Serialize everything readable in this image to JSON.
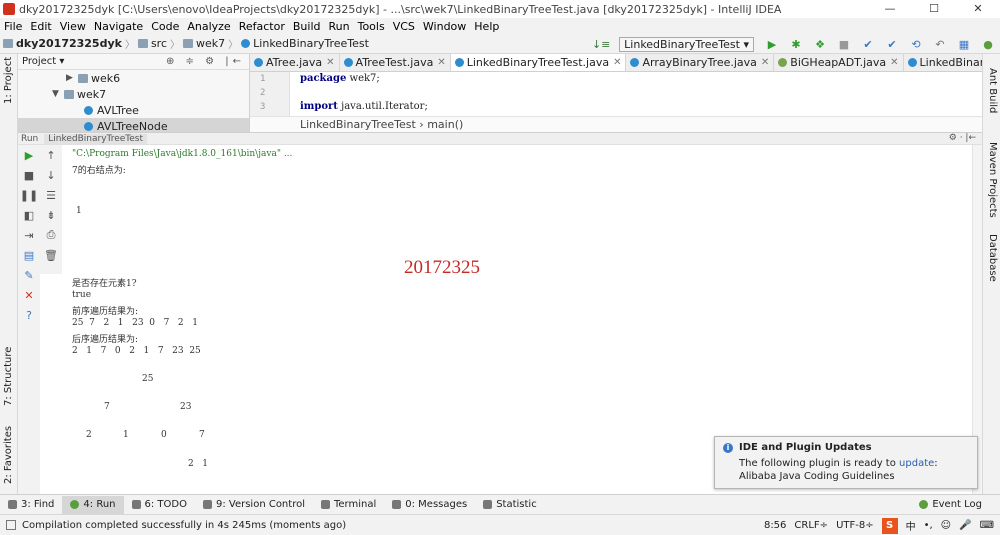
{
  "window": {
    "title": "dky20172325dyk [C:\\Users\\enovo\\IdeaProjects\\dky20172325dyk] - ...\\src\\wek7\\LinkedBinaryTreeTest.java [dky20172325dyk] - IntelliJ IDEA",
    "minimize": "—",
    "maximize": "☐",
    "close": "✕"
  },
  "menu": [
    "File",
    "Edit",
    "View",
    "Navigate",
    "Code",
    "Analyze",
    "Refactor",
    "Build",
    "Run",
    "Tools",
    "VCS",
    "Window",
    "Help"
  ],
  "breadcrumb": {
    "project": "dky20172325dyk",
    "src": "src",
    "package": "wek7",
    "file": "LinkedBinaryTreeTest"
  },
  "toolbar": {
    "run_config": "LinkedBinaryTreeTest ▾"
  },
  "sidebar": {
    "project_tab": "1: Project",
    "structure_tab": "7: Structure",
    "favorites_tab": "2: Favorites"
  },
  "right_sidebar": {
    "ant": "Ant Build",
    "maven": "Maven Projects",
    "database": "Database"
  },
  "project_panel": {
    "header": "Project ▾",
    "items": [
      {
        "label": "wek6",
        "arrow": "▶"
      },
      {
        "label": "wek7",
        "arrow": "▼"
      },
      {
        "label": "AVLTree",
        "arrow": ""
      },
      {
        "label": "AVLTreeNode",
        "arrow": ""
      }
    ]
  },
  "editor": {
    "tabs": [
      {
        "label": "ATree.java",
        "kind": "class"
      },
      {
        "label": "ATreeTest.java",
        "kind": "class"
      },
      {
        "label": "LinkedBinaryTreeTest.java",
        "kind": "class",
        "active": true
      },
      {
        "label": "ArrayBinaryTree.java",
        "kind": "class"
      },
      {
        "label": "BiGHeapADT.java",
        "kind": "interface"
      },
      {
        "label": "LinkedBinaryTree.java",
        "kind": "class"
      }
    ],
    "gutter": [
      "1",
      "2",
      "3"
    ],
    "line1_kw": "package",
    "line1_rest": " wek7;",
    "line3_kw": "import",
    "line3_rest": " java.util.Iterator;",
    "crumb": "LinkedBinaryTreeTest  ›  main()"
  },
  "run_panel": {
    "label": "Run",
    "tab": "LinkedBinaryTreeTest",
    "settings": "⚙ ·  |←"
  },
  "console": {
    "cmd": "\"C:\\Program Files\\Java\\jdk1.8.0_161\\bin\\java\" ...",
    "line_right": "7的右结点为:",
    "line_1": "1",
    "line_exists": "是否存在元素1?",
    "line_true": "true",
    "line_pre_title": "前序遍历结果为:",
    "line_pre": "25  7   2   1   23  0   7   2   1",
    "line_post_title": "后序遍历结果为:",
    "line_post": "2   1   7   0   2   1   7   23  25",
    "tree_l1": "25",
    "tree_l2a": "7",
    "tree_l2b": "23",
    "tree_l3a": "2",
    "tree_l3b": "1",
    "tree_l3c": "0",
    "tree_l3d": "7",
    "tree_l4": "2   1",
    "watermark": "20172325"
  },
  "popup": {
    "title": "IDE and Plugin Updates",
    "body_prefix": "The following plugin is ready to ",
    "link": "update",
    "body_suffix": ":",
    "plugin": "Alibaba Java Coding Guidelines"
  },
  "bottom_tools": {
    "find": "3: Find",
    "run": "4: Run",
    "todo": "6: TODO",
    "vcs": "9: Version Control",
    "terminal": "Terminal",
    "messages": "0: Messages",
    "statistic": "Statistic",
    "event_log": "Event Log"
  },
  "status": {
    "message": "Compilation completed successfully in 4s 245ms (moments ago)",
    "position": "8:56",
    "line_sep": "CRLF÷",
    "encoding": "UTF-8÷",
    "ime": "S"
  }
}
